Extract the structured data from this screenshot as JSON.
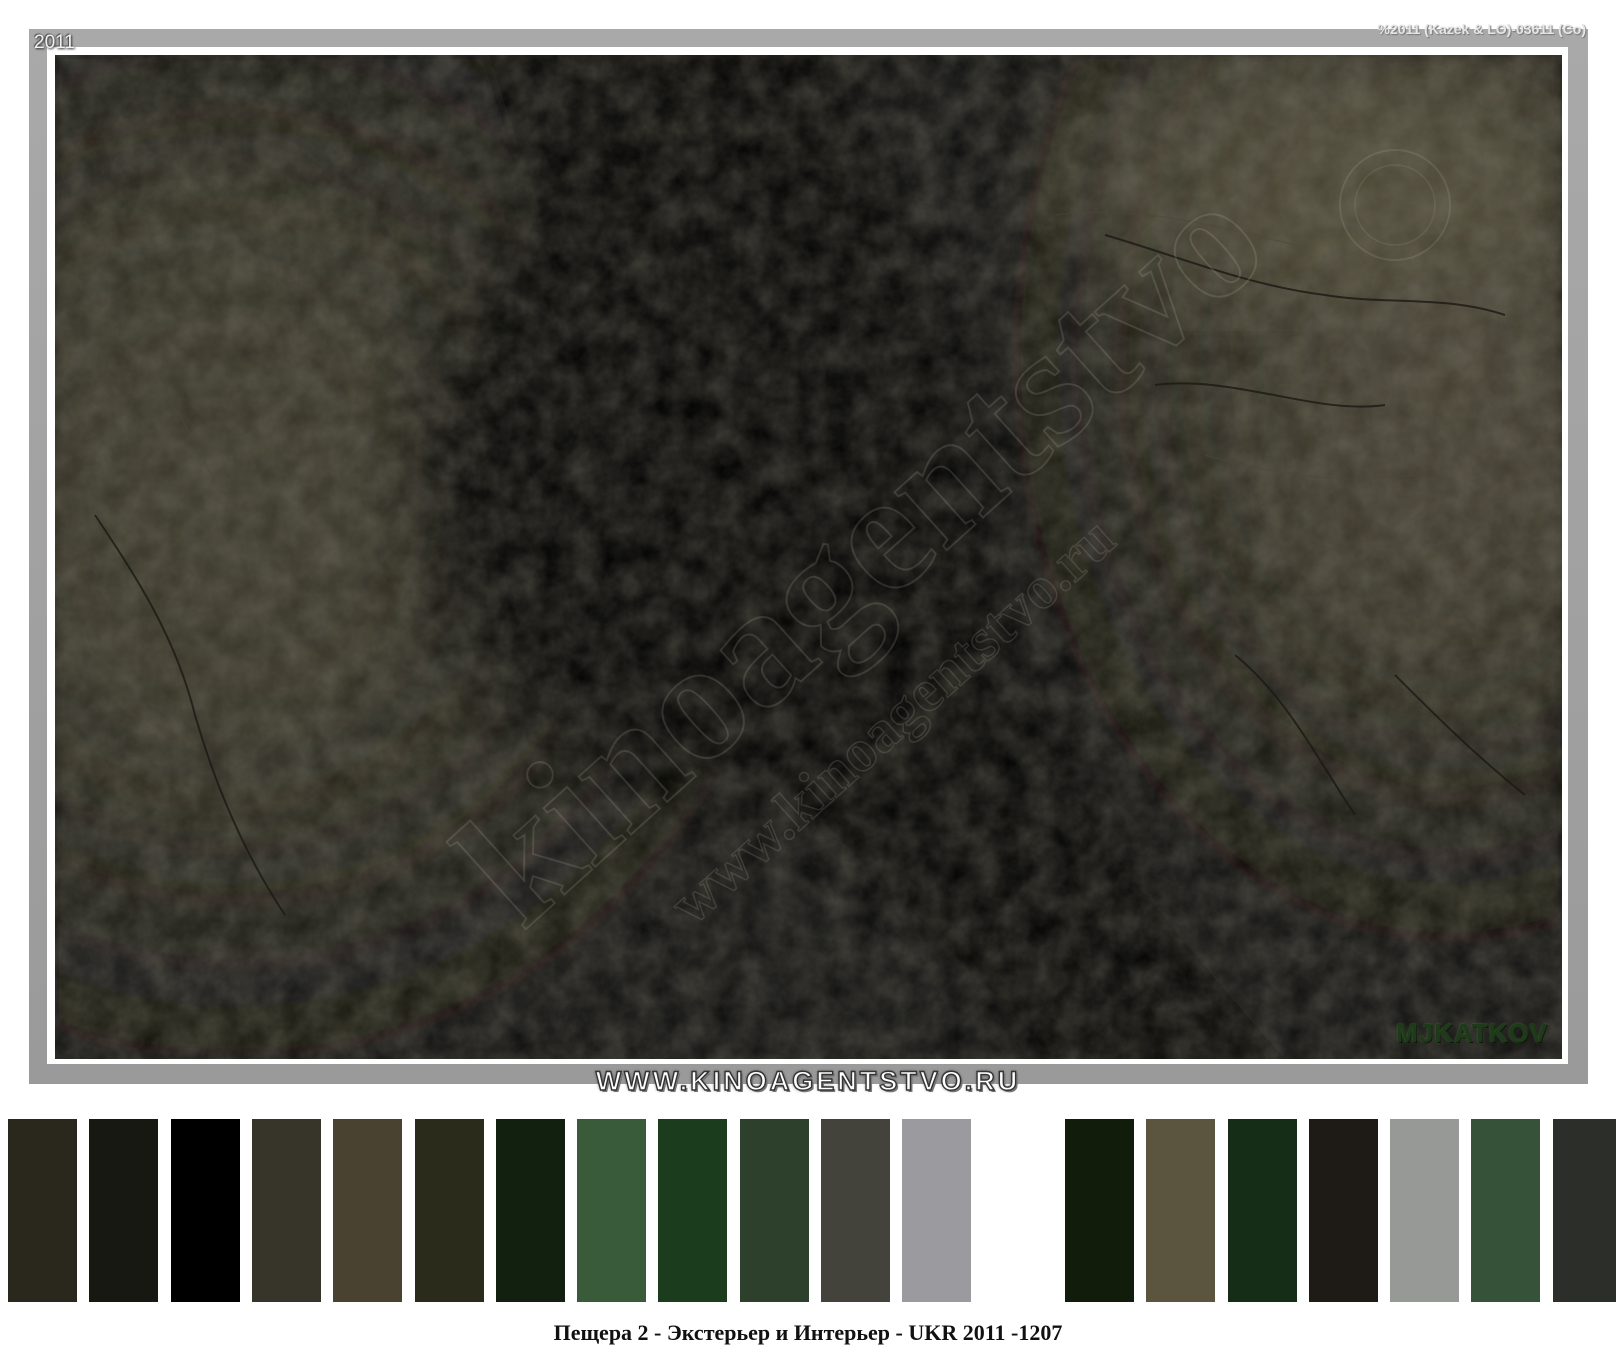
{
  "photo": {
    "year_label": "2011",
    "copyright": "%2011 (Kazek & LO)-03611 (Co)",
    "photographer_mark": "MJKATKOV",
    "watermark_large": "kinoagentstvo",
    "watermark_small": "www.kinoagentstvo.ru",
    "subject": "cave"
  },
  "banner": {
    "website": "WWW.KINOAGENTSTVO.RU"
  },
  "palette": {
    "swatches": [
      "#2a271c",
      "#181812",
      "#000000",
      "#37342a",
      "#4a4230",
      "#2b2b1b",
      "#11200f",
      "#3a5b3a",
      "#1b3c1d",
      "#2d402b",
      "#43433b",
      "#9b9b9f",
      "#ffffff",
      "#121c0b",
      "#5b553f",
      "#152c17",
      "#1e1b16",
      "#979997",
      "#365238",
      "#2c2e29"
    ]
  },
  "caption": {
    "text": "Пещера 2 - Экстерьер и Интерьер - UKR 2011 -1207"
  }
}
